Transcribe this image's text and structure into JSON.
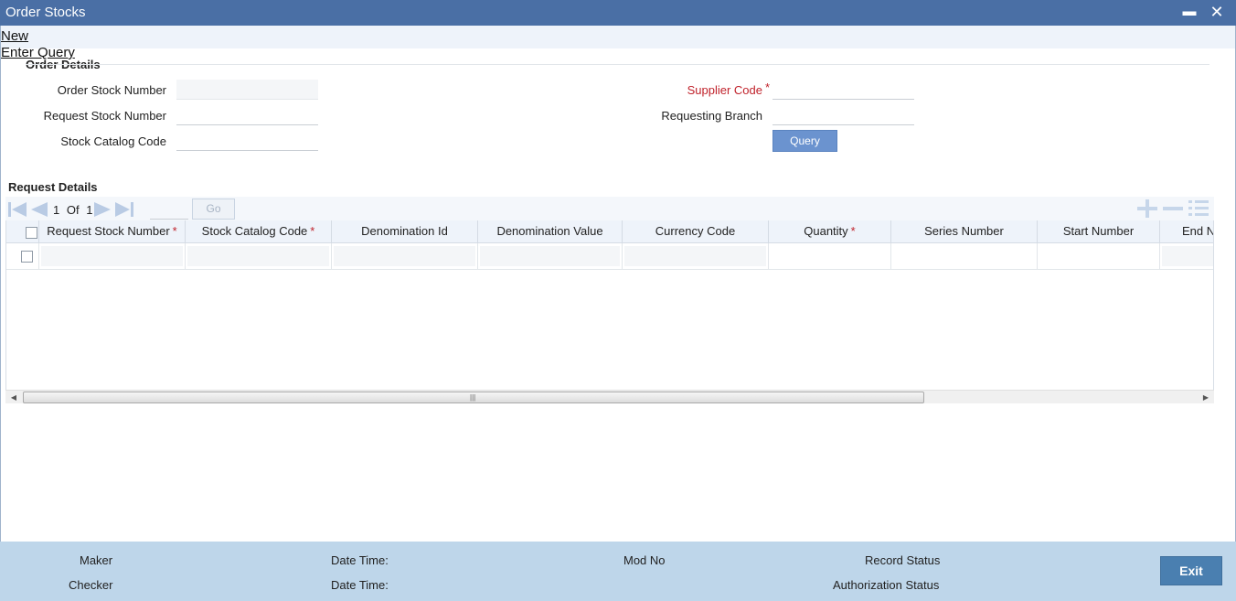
{
  "window": {
    "title": "Order Stocks",
    "minimize_glyph": "▬",
    "close_glyph": "✕"
  },
  "menu": {
    "new_label": "New",
    "enter_query_label": "Enter Query"
  },
  "order_details": {
    "section_title": "Order Details",
    "order_stock_number": {
      "label": "Order Stock Number",
      "value": ""
    },
    "request_stock_number": {
      "label": "Request Stock Number",
      "value": ""
    },
    "stock_catalog_code": {
      "label": "Stock Catalog Code",
      "value": ""
    },
    "supplier_code": {
      "label": "Supplier Code",
      "required_mark": "*",
      "value": ""
    },
    "requesting_branch": {
      "label": "Requesting Branch",
      "value": ""
    },
    "query_button": "Query"
  },
  "request_details": {
    "section_title": "Request Details",
    "pager": {
      "current": "1",
      "of_label": "Of",
      "total": "1"
    },
    "go_button": "Go",
    "required_mark": "*",
    "columns": [
      {
        "label": "Request Stock Number",
        "required": true
      },
      {
        "label": "Stock Catalog Code",
        "required": true
      },
      {
        "label": "Denomination Id",
        "required": false
      },
      {
        "label": "Denomination Value",
        "required": false
      },
      {
        "label": "Currency Code",
        "required": false
      },
      {
        "label": "Quantity",
        "required": true
      },
      {
        "label": "Series Number",
        "required": false
      },
      {
        "label": "Start Number",
        "required": false
      },
      {
        "label": "End N",
        "required": false
      }
    ],
    "scroll_left_glyph": "◀",
    "scroll_right_glyph": "▶",
    "scroll_grip_glyph": "|||"
  },
  "footer": {
    "maker_label": "Maker",
    "checker_label": "Checker",
    "date_time_label_1": "Date Time:",
    "date_time_label_2": "Date Time:",
    "mod_no_label": "Mod No",
    "record_status_label": "Record Status",
    "authorization_status_label": "Authorization Status",
    "exit_button": "Exit"
  },
  "colors": {
    "titlebar": "#4a6fa5",
    "footer": "#bed6ea",
    "required": "#c0222b",
    "query_button": "#6b93cf",
    "exit_button": "#4a7fb0"
  }
}
